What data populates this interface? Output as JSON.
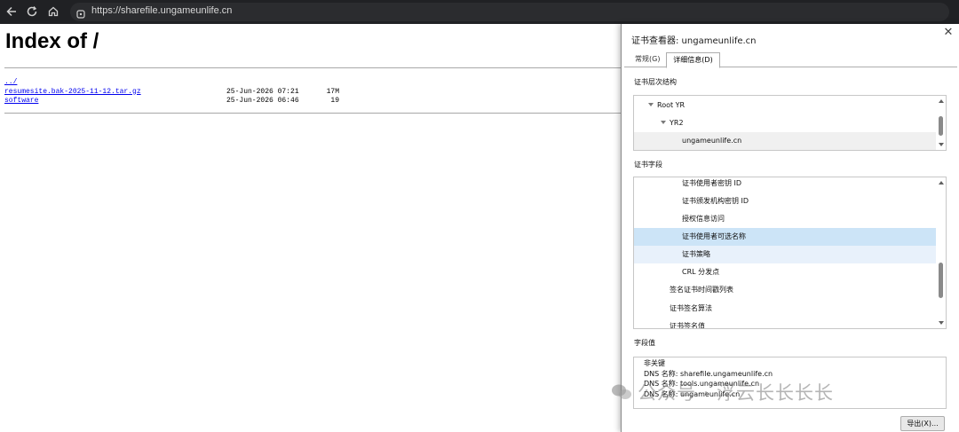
{
  "browser": {
    "url": "https://sharefile.ungameunlife.cn"
  },
  "page": {
    "title": "Index of /",
    "files": [
      {
        "name": "../",
        "date": "",
        "size": ""
      },
      {
        "name": "resumesite.bak-2025-11-12.tar.gz",
        "date": "25-Jun-2026 07:21",
        "size": "17M"
      },
      {
        "name": "software",
        "date": "25-Jun-2026 06:46",
        "size": "19"
      }
    ]
  },
  "dialog": {
    "title": "证书查看器: ungameunlife.cn",
    "close": "✕",
    "tabs": [
      "常规(G)",
      "详细信息(D)"
    ],
    "hierarchy_label": "证书层次结构",
    "hierarchy": [
      "Root YR",
      "YR2",
      "ungameunlife.cn"
    ],
    "fields_label": "证书字段",
    "fields": [
      "证书使用者密钥 ID",
      "证书颁发机构密钥 ID",
      "授权信息访问",
      "证书使用者可选名称",
      "证书策略",
      "CRL 分发点",
      "签名证书时间戳列表",
      "证书签名算法",
      "证书签名值"
    ],
    "value_label": "字段值",
    "values": [
      "非关键",
      "DNS 名称: sharefile.ungameunlife.cn",
      "DNS 名称: tools.ungameunlife.cn",
      "DNS 名称: ungameunlife.cn"
    ],
    "export_label": "导出(X)..."
  },
  "watermark": {
    "text": "公众号 · 浮云长长长长"
  },
  "colors": {
    "toolbar": "#202124",
    "link": "#0000ee",
    "selection": "#cce4f7"
  }
}
